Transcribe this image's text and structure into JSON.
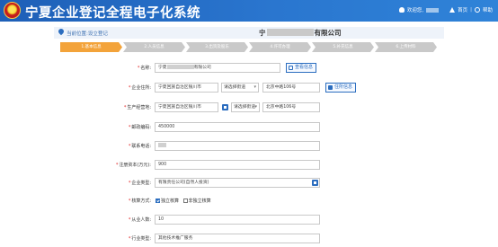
{
  "header": {
    "title": "宁夏企业登记全程电子化系统",
    "welcome": "欢迎您,",
    "home": "首页",
    "help": "帮助"
  },
  "location": {
    "prefix": "当前位置:",
    "value": "设立登记",
    "company_prefix": "宁",
    "company_suffix": "有限公司"
  },
  "steps": [
    "1.基本信息",
    "2.人员信息",
    "3.出资及股东",
    "4.许可办理",
    "5.补充信息",
    "6.上传材料"
  ],
  "form": {
    "name": {
      "label": "名称:",
      "value_prefix": "宁夏",
      "value_suffix": "有限公司",
      "button": "查看信息"
    },
    "residence": {
      "label": "企业住所:",
      "city": "宁夏回族自治区银川市",
      "street_select": "请选择街道",
      "detail": "北京中路106号",
      "button": "住所信息"
    },
    "production": {
      "label": "生产经营地:",
      "city": "宁夏回族自治区银川市",
      "street_select": "请选择街道",
      "detail": "北京中路106号"
    },
    "postcode": {
      "label": "邮政编码:",
      "value": "450000"
    },
    "phone": {
      "label": "联系电话:"
    },
    "capital": {
      "label": "注册资本(万元):",
      "value": "900"
    },
    "enterprise_type": {
      "label": "企业类型:",
      "value": "有限责任公司(自然人投资)"
    },
    "accounting": {
      "label": "核算方式:",
      "options": [
        "独立核算",
        "非独立核算"
      ],
      "selected": "独立核算"
    },
    "employees": {
      "label": "从业人数:",
      "value": "10"
    },
    "industry": {
      "label": "行业类型:",
      "value": "其他技术推广服务"
    }
  },
  "colors": {
    "header_blue": "#2a76cf",
    "step_active": "#f3a33a",
    "step_inactive": "#c9c9c9",
    "required": "#e02020"
  }
}
